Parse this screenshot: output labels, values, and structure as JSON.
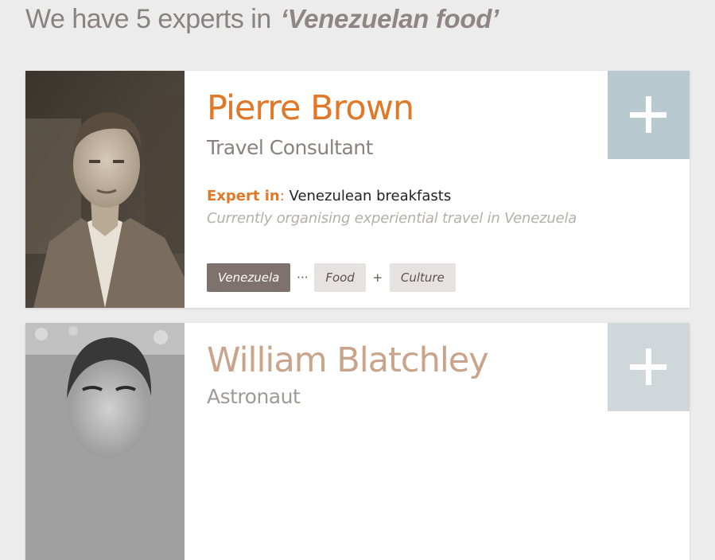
{
  "header": {
    "prefix": "We have 5 experts in",
    "query": "‘Venezuelan food’"
  },
  "experts": [
    {
      "name": "Pierre Brown",
      "role": "Travel Consultant",
      "expert_label": "Expert in",
      "expert_colon": ":",
      "expertise": " Venezulean breakfasts",
      "status": "Currently organising experiential travel in Venezuela",
      "tags": {
        "primary": "Venezuela",
        "sep1": "···",
        "second": "Food",
        "sep2": "+",
        "third": "Culture"
      },
      "add_icon": "plus-icon"
    },
    {
      "name": "William Blatchley",
      "role": "Astronaut",
      "add_icon": "plus-icon"
    }
  ],
  "colors": {
    "accent_orange": "#e07828",
    "add_button_bg": "#b9c9d0",
    "tag_primary_bg": "#7f716d",
    "tag_secondary_bg": "#e5e2e1"
  }
}
